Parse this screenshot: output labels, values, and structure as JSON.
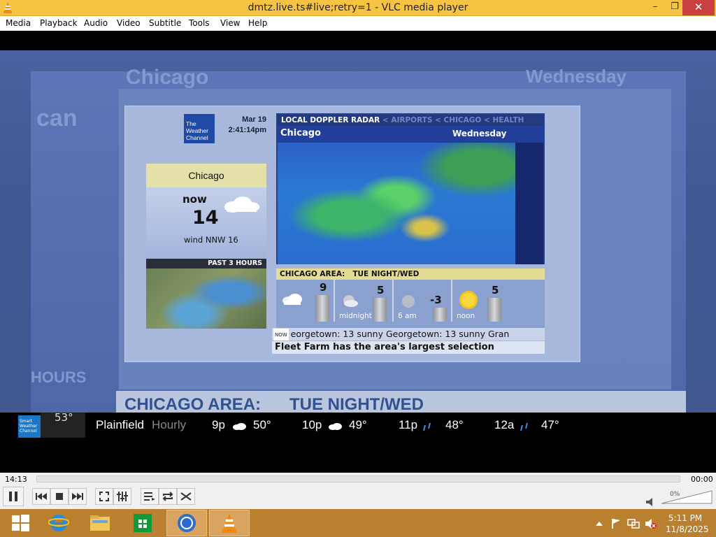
{
  "window": {
    "title": "dmtz.live.ts#live;retry=1 - VLC media player",
    "minimize": "–",
    "maximize": "❐",
    "close": "✕"
  },
  "menu": [
    "Media",
    "Playback",
    "Audio",
    "Video",
    "Subtitle",
    "Tools",
    "View",
    "Help"
  ],
  "video_frame": {
    "ghost_city": "Chicago",
    "ghost_day": "Wednesday",
    "ghost_left": "can",
    "ghost_hours": "HOURS",
    "ghost_area": "CHICAGO AREA:",
    "ghost_period": "TUE NIGHT/WED",
    "logo": "The Weather Channel",
    "date": "Mar 19",
    "time": "2:41:14pm",
    "now_card": {
      "city": "Chicago",
      "now": "now",
      "temp": "14",
      "wind": "wind NNW 16",
      "past_label": "PAST 3 HOURS"
    },
    "radar": {
      "header": "LOCAL DOPPLER RADAR",
      "tabs": [
        "AIRPORTS",
        "CHICAGO",
        "HEALTH"
      ],
      "city": "Chicago",
      "day": "Wednesday"
    },
    "forecast": {
      "header_area": "CHICAGO AREA:",
      "header_period": "TUE NIGHT/WED",
      "periods": [
        {
          "label": "",
          "value": "9",
          "icon": "partly-cloudy-icon"
        },
        {
          "label": "midnight",
          "value": "5",
          "icon": "cloudy-moon-icon"
        },
        {
          "label": "6 am",
          "value": "-3",
          "icon": "moon-icon"
        },
        {
          "label": "noon",
          "value": "5",
          "icon": "sun-icon"
        }
      ]
    },
    "ticker_now": "NOW",
    "ticker_line1": "eorgetown: 13 sunny Georgetown: 13 sunny  Gran",
    "ticker_line2": "Fleet Farm has the area's largest selection"
  },
  "bottom_strip": {
    "logo": "Smart Weather Channel",
    "current_temp": "53°",
    "location": "Plainfield",
    "mode": "Hourly",
    "hours": [
      {
        "time": "9p",
        "temp": "50°",
        "icon": "cloud-icon"
      },
      {
        "time": "10p",
        "temp": "49°",
        "icon": "cloud-icon"
      },
      {
        "time": "11p",
        "temp": "48°",
        "icon": "rain-icon"
      },
      {
        "time": "12a",
        "temp": "47°",
        "icon": "rain-icon"
      }
    ]
  },
  "player": {
    "elapsed": "14:13",
    "remaining": "00:00",
    "volume": "0%",
    "progress": 0
  },
  "taskbar": {
    "time": "5:11 PM",
    "date": "11/8/2025"
  }
}
